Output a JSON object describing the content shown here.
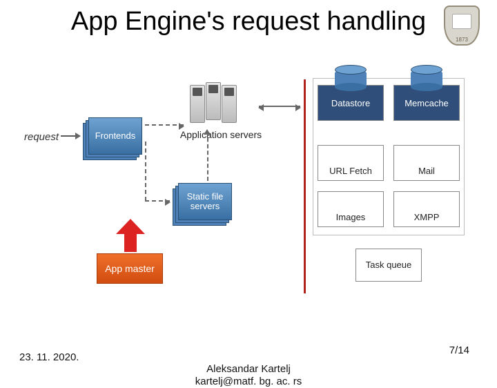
{
  "title": "App Engine's request handling",
  "crest_year": "1873",
  "diagram": {
    "request_label": "request",
    "frontends": "Frontends",
    "app_servers": "Application servers",
    "static_servers": "Static file servers",
    "app_master": "App master",
    "services": {
      "datastore": "Datastore",
      "memcache": "Memcache",
      "url_fetch": "URL Fetch",
      "mail": "Mail",
      "images": "Images",
      "xmpp": "XMPP",
      "task_queue": "Task queue"
    }
  },
  "footer": {
    "date": "23. 11. 2020.",
    "author": "Aleksandar Kartelj",
    "email": "kartelj@matf. bg. ac. rs",
    "page": "7/14"
  }
}
